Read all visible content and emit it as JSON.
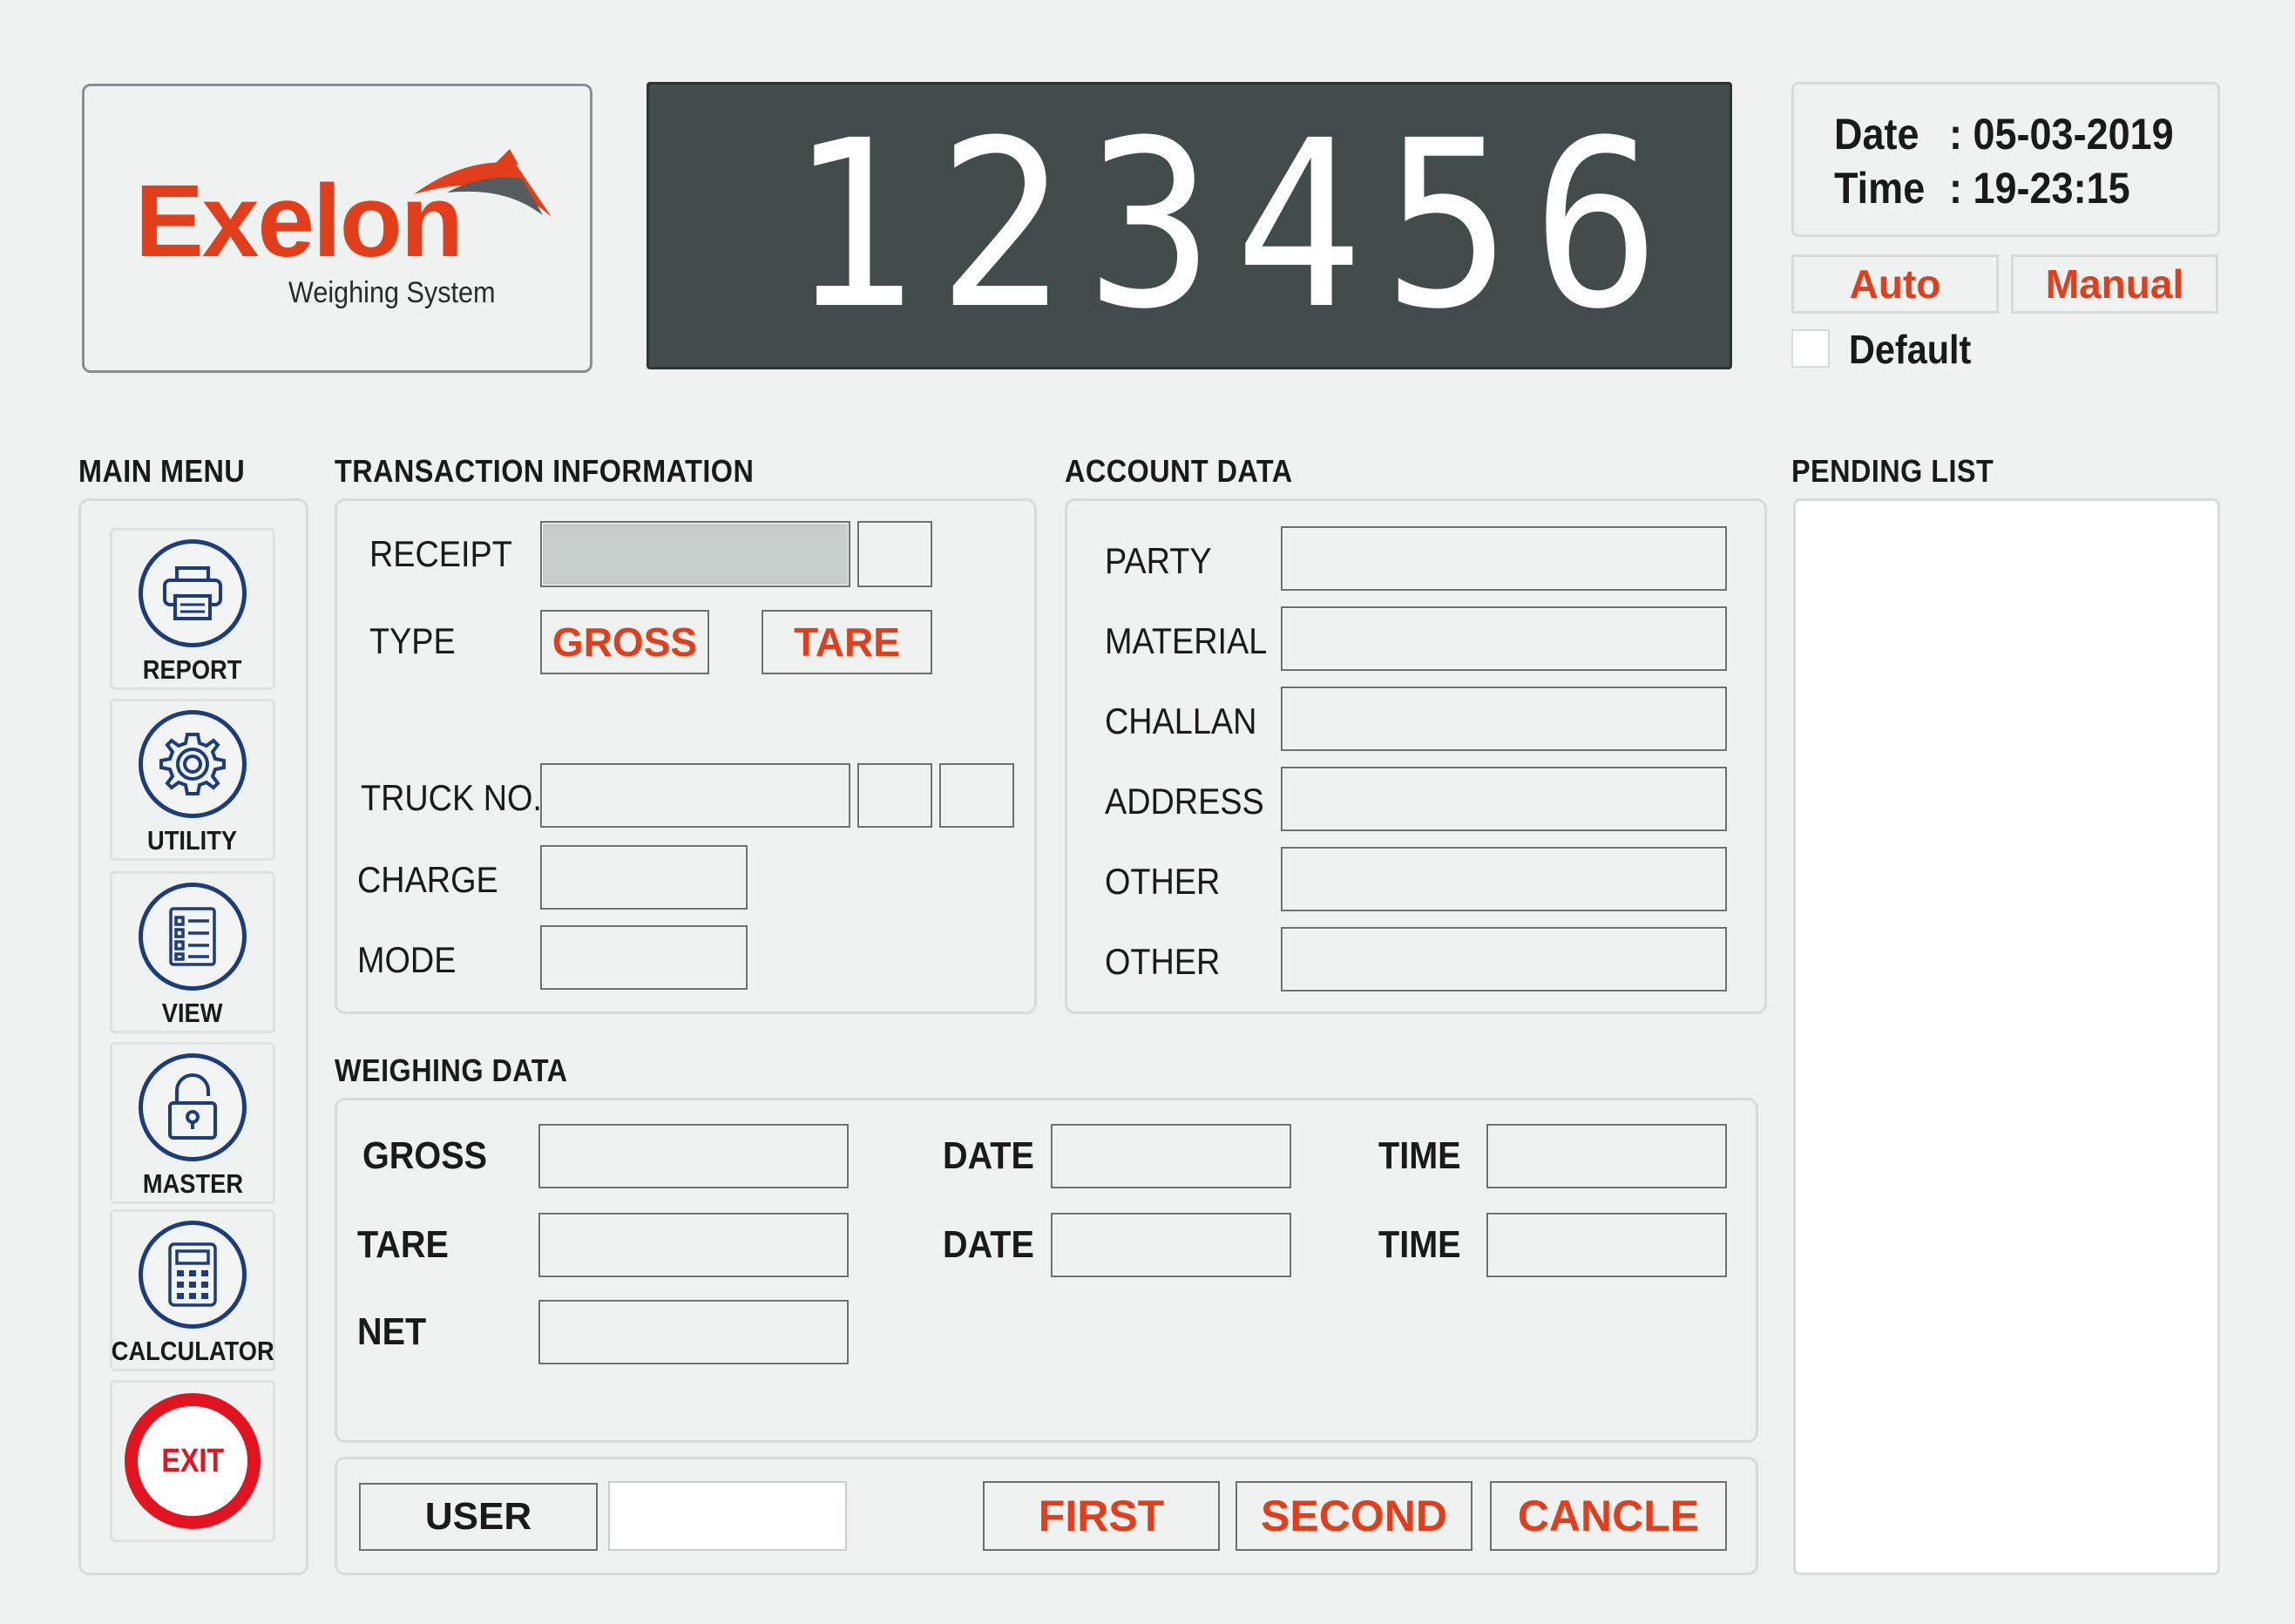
{
  "logo": {
    "brand": "Exelon",
    "tagline": "Weighing System"
  },
  "display": {
    "value": "123456"
  },
  "datetime": {
    "date_label": "Date",
    "date_value": ": 05-03-2019",
    "time_label": "Time",
    "time_value": ": 19-23:15"
  },
  "mode": {
    "auto_label": "Auto",
    "manual_label": "Manual",
    "default_label": "Default"
  },
  "main_menu": {
    "title": "MAIN MENU",
    "items": [
      {
        "label": "REPORT",
        "icon": "printer-icon"
      },
      {
        "label": "UTILITY",
        "icon": "gear-icon"
      },
      {
        "label": "VIEW",
        "icon": "checklist-icon"
      },
      {
        "label": "MASTER",
        "icon": "lock-icon"
      },
      {
        "label": "CALCULATOR",
        "icon": "calculator-icon"
      }
    ],
    "exit_label": "EXIT"
  },
  "transaction": {
    "title": "TRANSACTION INFORMATION",
    "receipt_label": "RECEIPT",
    "type_label": "TYPE",
    "gross_button": "GROSS",
    "tare_button": "TARE",
    "truck_label": "TRUCK NO.",
    "charge_label": "CHARGE",
    "mode_label": "MODE"
  },
  "account": {
    "title": "ACCOUNT DATA",
    "fields": [
      "PARTY",
      "MATERIAL",
      "CHALLAN",
      "ADDRESS",
      "OTHER",
      "OTHER"
    ]
  },
  "pending": {
    "title": "PENDING LIST"
  },
  "weighing": {
    "title": "WEIGHING DATA",
    "gross_label": "GROSS",
    "tare_label": "TARE",
    "net_label": "NET",
    "date_label": "DATE",
    "time_label": "TIME"
  },
  "actions": {
    "user_label": "USER",
    "first_label": "FIRST",
    "second_label": "SECOND",
    "cancel_label": "CANCLE"
  },
  "colors": {
    "accent_red": "#e23e1b",
    "menu_blue": "#1d3c7c",
    "display_bg": "#424c4b"
  }
}
